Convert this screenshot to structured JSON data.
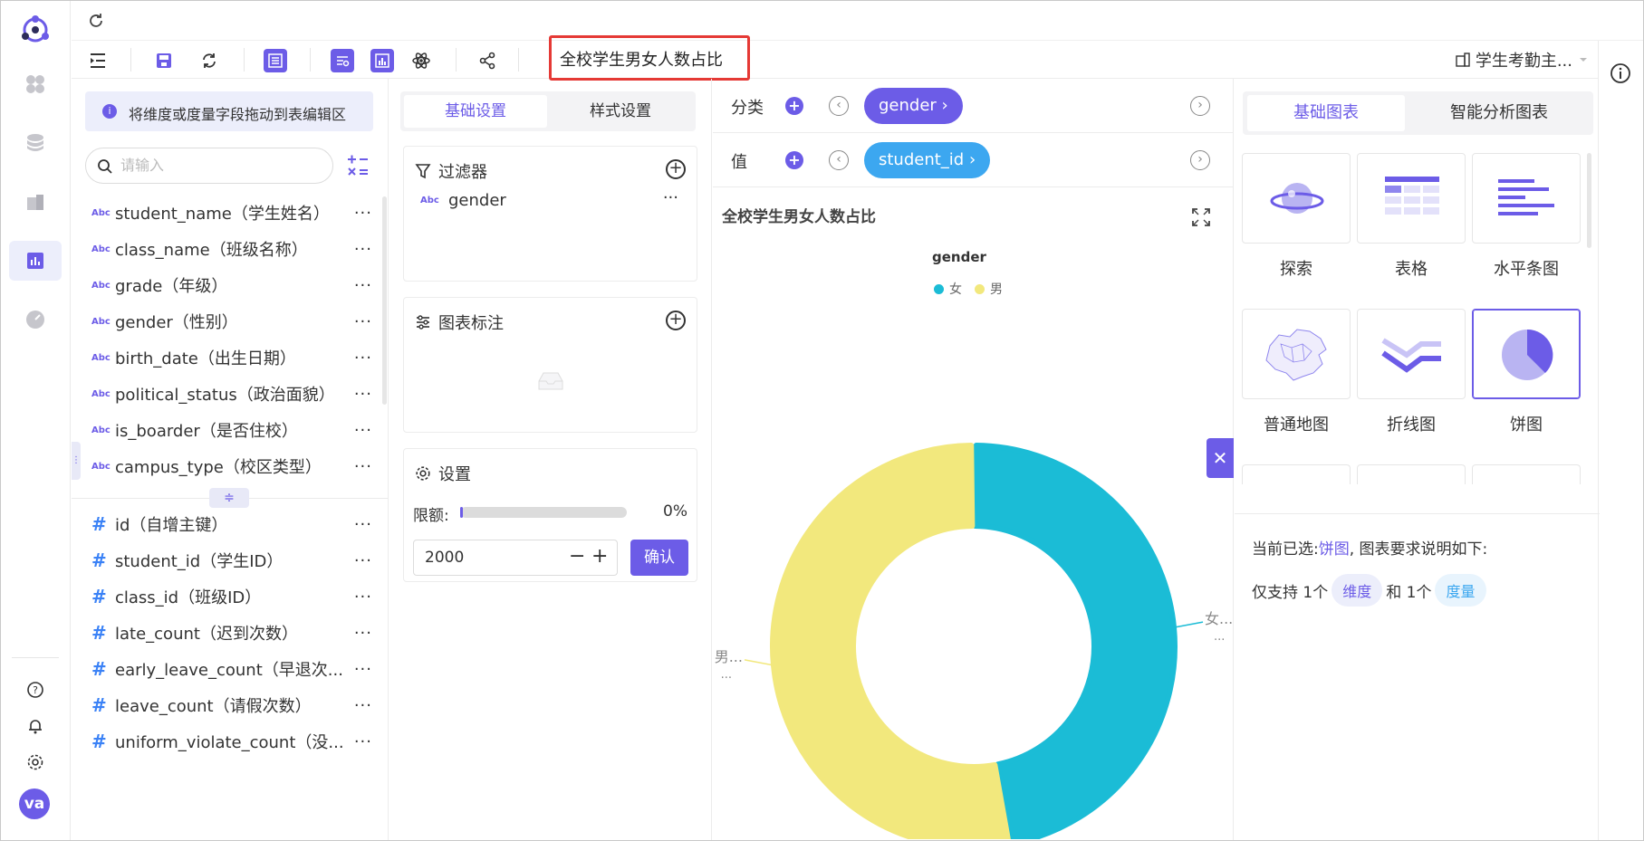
{
  "topbar": {
    "refresh_icon": "refresh-icon"
  },
  "toolbar": {
    "chart_title": "全校学生男女人数占比",
    "dataset_name": "学生考勤主..."
  },
  "fields": {
    "hint": "将维度或度量字段拖动到表编辑区",
    "search_placeholder": "请输入",
    "dimensions": [
      {
        "type": "Abc",
        "label": "student_name（学生姓名）"
      },
      {
        "type": "Abc",
        "label": "class_name（班级名称）"
      },
      {
        "type": "Abc",
        "label": "grade（年级）"
      },
      {
        "type": "Abc",
        "label": "gender（性别）"
      },
      {
        "type": "Abc",
        "label": "birth_date（出生日期）"
      },
      {
        "type": "Abc",
        "label": "political_status（政治面貌）"
      },
      {
        "type": "Abc",
        "label": "is_boarder（是否住校）"
      },
      {
        "type": "Abc",
        "label": "campus_type（校区类型）"
      }
    ],
    "measures": [
      {
        "type": "#",
        "label": "id（自增主键）"
      },
      {
        "type": "#",
        "label": "student_id（学生ID）"
      },
      {
        "type": "#",
        "label": "class_id（班级ID）"
      },
      {
        "type": "#",
        "label": "late_count（迟到次数）"
      },
      {
        "type": "#",
        "label": "early_leave_count（早退次..."
      },
      {
        "type": "#",
        "label": "leave_count（请假次数）"
      },
      {
        "type": "#",
        "label": "uniform_violate_count（没..."
      }
    ],
    "more": "···"
  },
  "settings": {
    "tabs": [
      "基础设置",
      "样式设置"
    ],
    "filter_title": "过滤器",
    "filter_field_type": "Abc",
    "filter_field": "gender",
    "annotation_title": "图表标注",
    "setting_title": "设置",
    "quota_label": "限额:",
    "quota_value": "0%",
    "limit_value": "2000",
    "minus": "−",
    "plus": "+",
    "confirm": "确认"
  },
  "shelves": {
    "category_label": "分类",
    "category_field": "gender ›",
    "value_label": "值",
    "value_field": "student_id ›"
  },
  "chart_data": {
    "type": "pie",
    "title": "全校学生男女人数占比",
    "legend_title": "gender",
    "legend_position": "top",
    "categories": [
      "女",
      "男"
    ],
    "values": [
      47,
      53
    ],
    "colors": [
      "#1bbcd6",
      "#f2e87d"
    ],
    "outer_labels": [
      "女...",
      "男..."
    ],
    "outer_sublabel": "..."
  },
  "chart_types": {
    "tabs": [
      "基础图表",
      "智能分析图表"
    ],
    "items": [
      "探索",
      "表格",
      "水平条图",
      "普通地图",
      "折线图",
      "饼图"
    ],
    "selected": "饼图",
    "desc_prefix": "当前已选:",
    "desc_selected": "饼图",
    "desc_suffix": ", 图表要求说明如下:",
    "support_prefix": "仅支持 1个",
    "tag_dimension": "维度",
    "and": "和 1个",
    "tag_measure": "度量"
  },
  "user": {
    "initials": "va"
  },
  "colors": {
    "accent": "#6c5ce7",
    "cyan": "#1bbcd6",
    "yellow": "#f2e87d"
  }
}
